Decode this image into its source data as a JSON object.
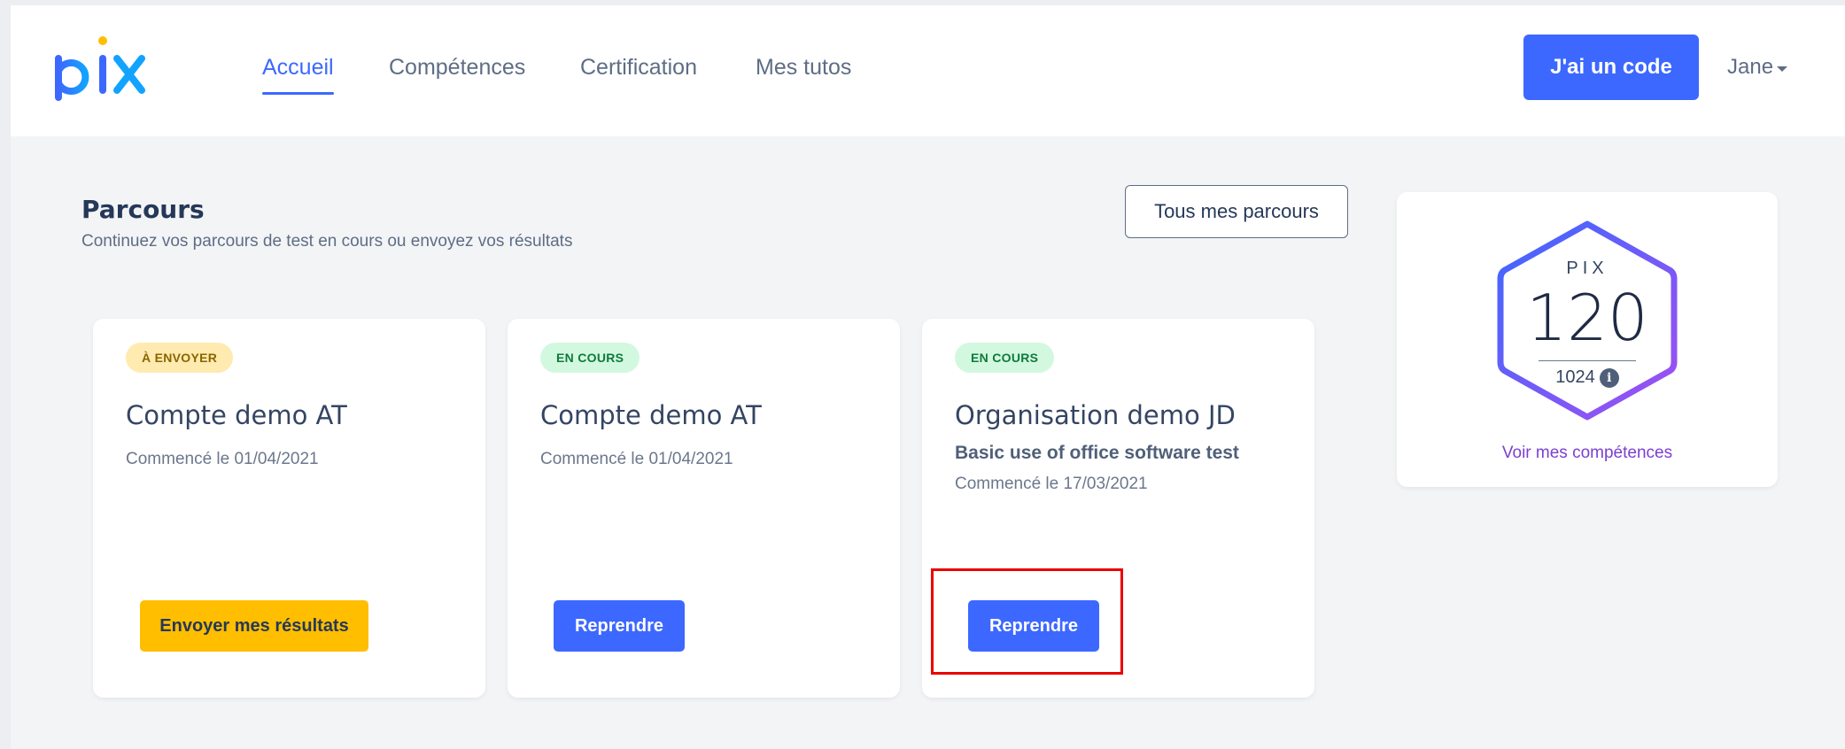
{
  "header": {
    "logo_text": "pix",
    "nav": [
      {
        "label": "Accueil",
        "active": true
      },
      {
        "label": "Compétences",
        "active": false
      },
      {
        "label": "Certification",
        "active": false
      },
      {
        "label": "Mes tutos",
        "active": false
      }
    ],
    "code_button": "J'ai un code",
    "user_name": "Jane"
  },
  "parcours": {
    "title": "Parcours",
    "subtitle": "Continuez vos parcours de test en cours ou envoyez vos résultats",
    "all_button": "Tous mes parcours",
    "cards": [
      {
        "badge": "À ENVOYER",
        "badge_color": "#ffeab0",
        "title": "Compte demo AT",
        "subtitle": "",
        "date": "Commencé le 01/04/2021",
        "button": "Envoyer mes résultats"
      },
      {
        "badge": "EN COURS",
        "badge_color": "#d3f8e0",
        "title": "Compte demo AT",
        "subtitle": "",
        "date": "Commencé le 01/04/2021",
        "button": "Reprendre"
      },
      {
        "badge": "EN COURS",
        "badge_color": "#d3f8e0",
        "title": "Organisation demo JD",
        "subtitle": "Basic use of office software test",
        "date": "Commencé le 17/03/2021",
        "button": "Reprendre"
      }
    ]
  },
  "score": {
    "label": "PIX",
    "value": "120",
    "max": "1024",
    "link": "Voir mes compétences"
  },
  "colors": {
    "primary": "#3d68ff",
    "warning": "#ffbe00",
    "highlight": "#ea0000",
    "link_purple": "#7d3fd0"
  },
  "icons": [
    "pix-logo",
    "info-icon",
    "caret-down-icon",
    "hexagon-badge"
  ]
}
